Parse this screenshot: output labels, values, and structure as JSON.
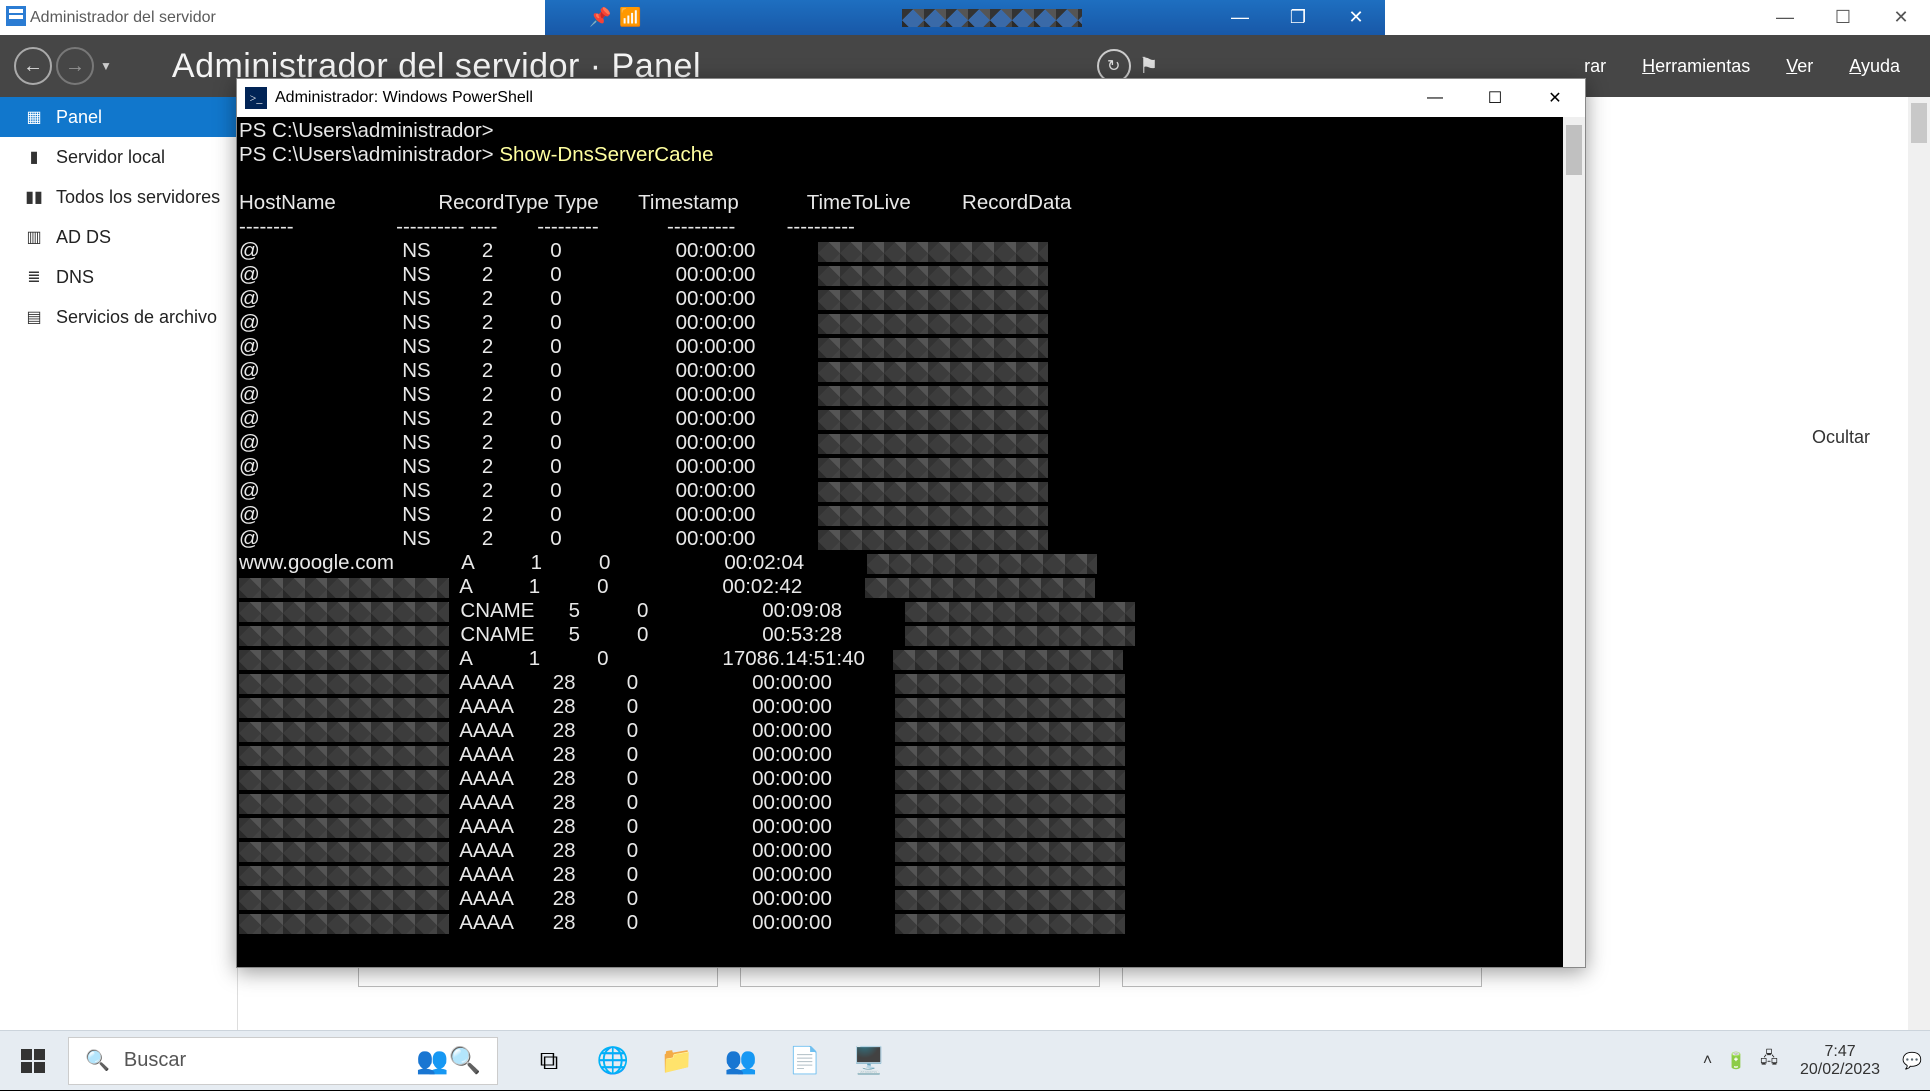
{
  "vm_bar": {
    "app_title": "Administrador del servidor",
    "pin_icon": "📌",
    "signal_icon": "📶"
  },
  "server_manager": {
    "breadcrumb_title": "Administrador del servidor · Panel",
    "menu": {
      "admin": "rar",
      "tools": "Herramientas",
      "view": "Ver",
      "help": "Ayuda"
    },
    "sidebar": {
      "items": [
        {
          "icon": "▦",
          "label": "Panel",
          "selected": true
        },
        {
          "icon": "▮",
          "label": "Servidor local"
        },
        {
          "icon": "▮▮",
          "label": "Todos los servidores"
        },
        {
          "icon": "▥",
          "label": "AD DS"
        },
        {
          "icon": "≣",
          "label": "DNS"
        },
        {
          "icon": "▤",
          "label": "Servicios de archivo"
        }
      ]
    },
    "ocultar": "Ocultar"
  },
  "powershell": {
    "title": "Administrador: Windows PowerShell",
    "prompt": "PS C:\\Users\\administrador>",
    "command": "Show-DnsServerCache",
    "columns": [
      "HostName",
      "RecordType",
      "Type",
      "Timestamp",
      "TimeToLive",
      "RecordData"
    ],
    "rows": [
      {
        "host": "@",
        "rtype": "NS",
        "type": "2",
        "ts": "0",
        "ttl": "00:00:00",
        "data_redacted": true
      },
      {
        "host": "@",
        "rtype": "NS",
        "type": "2",
        "ts": "0",
        "ttl": "00:00:00",
        "data_redacted": true
      },
      {
        "host": "@",
        "rtype": "NS",
        "type": "2",
        "ts": "0",
        "ttl": "00:00:00",
        "data_redacted": true
      },
      {
        "host": "@",
        "rtype": "NS",
        "type": "2",
        "ts": "0",
        "ttl": "00:00:00",
        "data_redacted": true
      },
      {
        "host": "@",
        "rtype": "NS",
        "type": "2",
        "ts": "0",
        "ttl": "00:00:00",
        "data_redacted": true
      },
      {
        "host": "@",
        "rtype": "NS",
        "type": "2",
        "ts": "0",
        "ttl": "00:00:00",
        "data_redacted": true
      },
      {
        "host": "@",
        "rtype": "NS",
        "type": "2",
        "ts": "0",
        "ttl": "00:00:00",
        "data_redacted": true
      },
      {
        "host": "@",
        "rtype": "NS",
        "type": "2",
        "ts": "0",
        "ttl": "00:00:00",
        "data_redacted": true
      },
      {
        "host": "@",
        "rtype": "NS",
        "type": "2",
        "ts": "0",
        "ttl": "00:00:00",
        "data_redacted": true
      },
      {
        "host": "@",
        "rtype": "NS",
        "type": "2",
        "ts": "0",
        "ttl": "00:00:00",
        "data_redacted": true
      },
      {
        "host": "@",
        "rtype": "NS",
        "type": "2",
        "ts": "0",
        "ttl": "00:00:00",
        "data_redacted": true
      },
      {
        "host": "@",
        "rtype": "NS",
        "type": "2",
        "ts": "0",
        "ttl": "00:00:00",
        "data_redacted": true
      },
      {
        "host": "@",
        "rtype": "NS",
        "type": "2",
        "ts": "0",
        "ttl": "00:00:00",
        "data_redacted": true
      },
      {
        "host": "www.google.com",
        "rtype": "A",
        "type": "1",
        "ts": "0",
        "ttl": "00:02:04",
        "data_redacted": true
      },
      {
        "host_redacted": true,
        "rtype": "A",
        "type": "1",
        "ts": "0",
        "ttl": "00:02:42",
        "data_redacted": true
      },
      {
        "host_redacted": true,
        "rtype": "CNAME",
        "type": "5",
        "ts": "0",
        "ttl": "00:09:08",
        "data_redacted": true
      },
      {
        "host_redacted": true,
        "rtype": "CNAME",
        "type": "5",
        "ts": "0",
        "ttl": "00:53:28",
        "data_redacted": true
      },
      {
        "host_redacted": true,
        "rtype": "A",
        "type": "1",
        "ts": "0",
        "ttl": "17086.14:51:40",
        "data_redacted": true
      },
      {
        "host_redacted": true,
        "rtype": "AAAA",
        "type": "28",
        "ts": "0",
        "ttl": "00:00:00",
        "data_redacted": true
      },
      {
        "host_redacted": true,
        "rtype": "AAAA",
        "type": "28",
        "ts": "0",
        "ttl": "00:00:00",
        "data_redacted": true
      },
      {
        "host_redacted": true,
        "rtype": "AAAA",
        "type": "28",
        "ts": "0",
        "ttl": "00:00:00",
        "data_redacted": true
      },
      {
        "host_redacted": true,
        "rtype": "AAAA",
        "type": "28",
        "ts": "0",
        "ttl": "00:00:00",
        "data_redacted": true
      },
      {
        "host_redacted": true,
        "rtype": "AAAA",
        "type": "28",
        "ts": "0",
        "ttl": "00:00:00",
        "data_redacted": true
      },
      {
        "host_redacted": true,
        "rtype": "AAAA",
        "type": "28",
        "ts": "0",
        "ttl": "00:00:00",
        "data_redacted": true
      },
      {
        "host_redacted": true,
        "rtype": "AAAA",
        "type": "28",
        "ts": "0",
        "ttl": "00:00:00",
        "data_redacted": true
      },
      {
        "host_redacted": true,
        "rtype": "AAAA",
        "type": "28",
        "ts": "0",
        "ttl": "00:00:00",
        "data_redacted": true
      },
      {
        "host_redacted": true,
        "rtype": "AAAA",
        "type": "28",
        "ts": "0",
        "ttl": "00:00:00",
        "data_redacted": true
      },
      {
        "host_redacted": true,
        "rtype": "AAAA",
        "type": "28",
        "ts": "0",
        "ttl": "00:00:00",
        "data_redacted": true
      },
      {
        "host_redacted": true,
        "rtype": "AAAA",
        "type": "28",
        "ts": "0",
        "ttl": "00:00:00",
        "data_redacted": true
      }
    ]
  },
  "taskbar": {
    "search_placeholder": "Buscar",
    "time": "7:47",
    "date": "20/02/2023"
  }
}
